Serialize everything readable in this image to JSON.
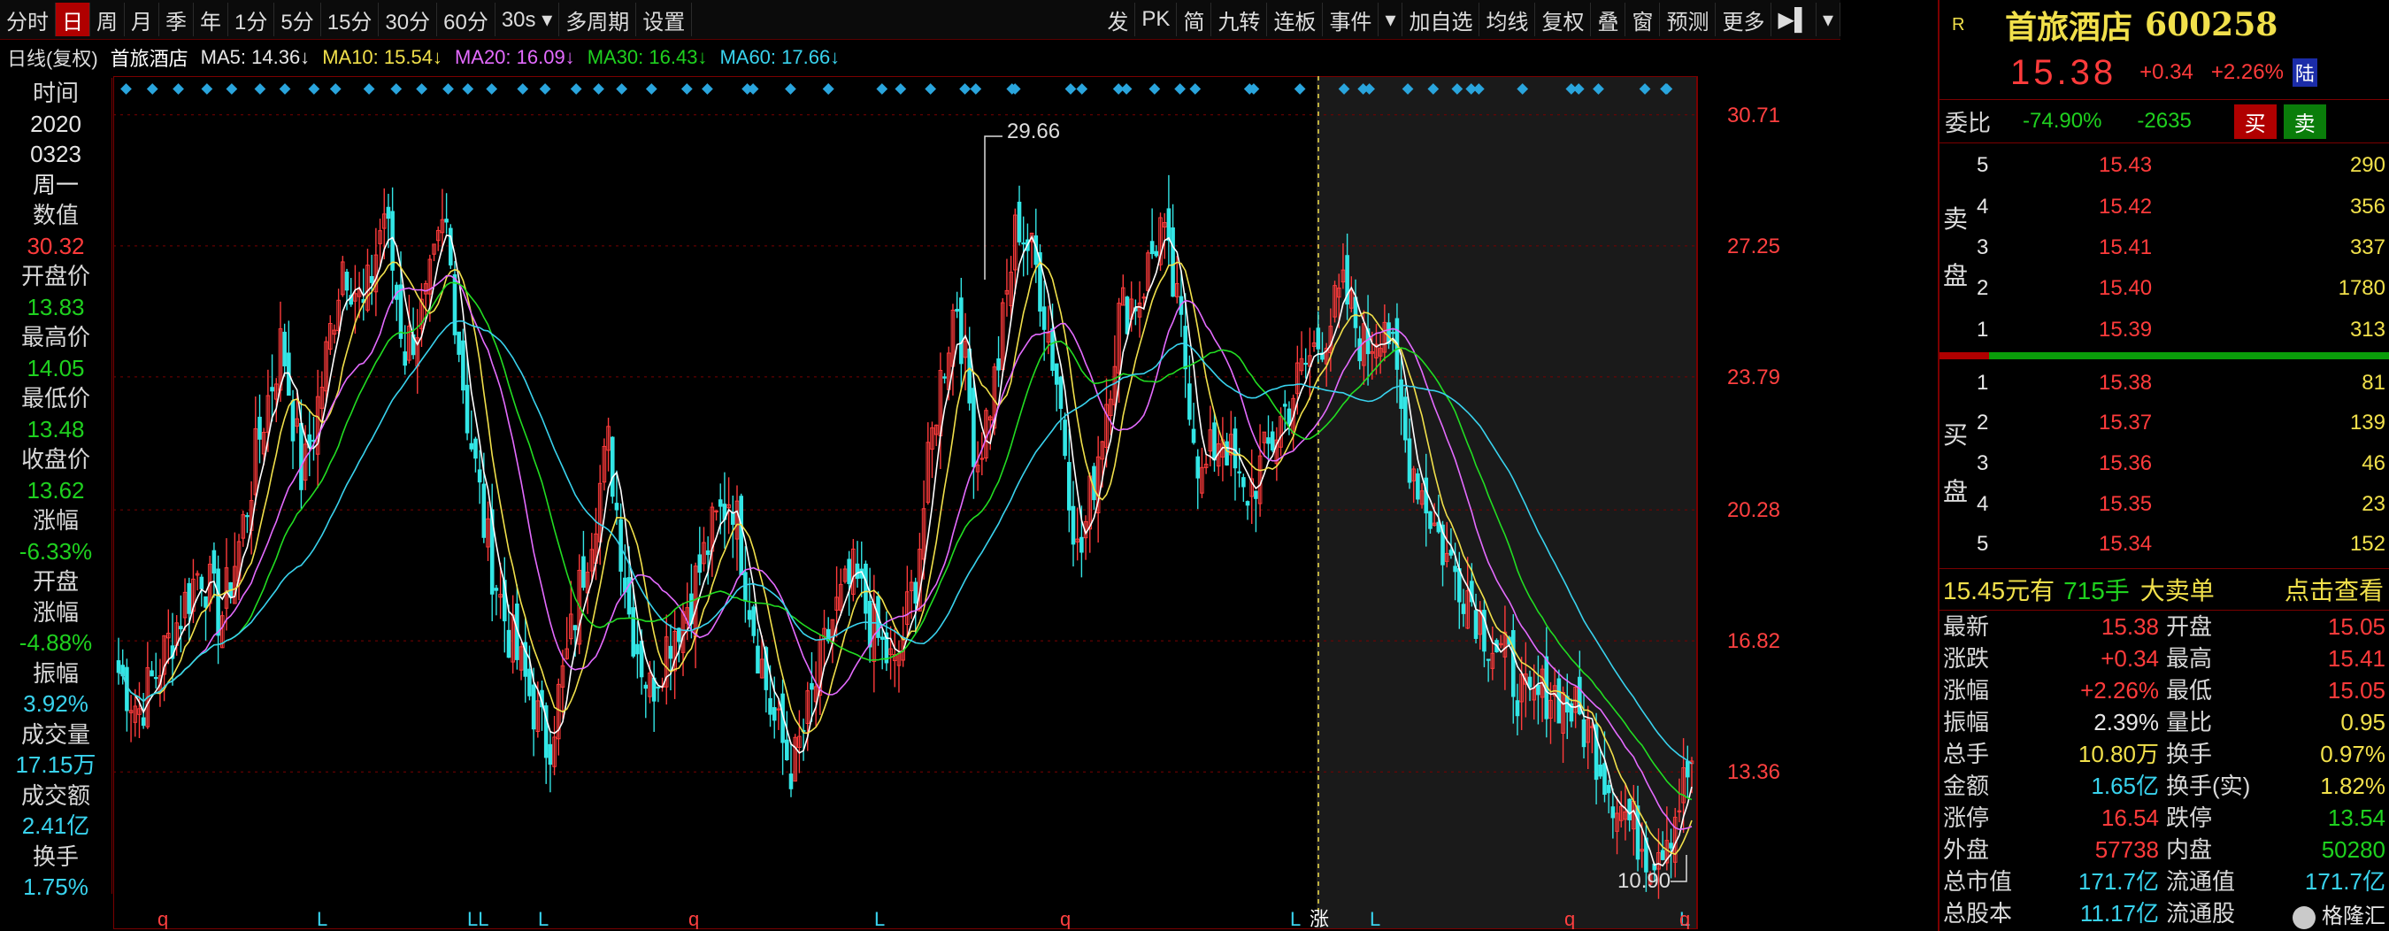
{
  "toolbar": {
    "left_items": [
      "分时",
      "日",
      "周",
      "月",
      "季",
      "年",
      "1分",
      "5分",
      "15分",
      "30分",
      "60分",
      "30s ▾",
      "多周期",
      "设置"
    ],
    "active_index": 1,
    "right_items": [
      "发",
      "PK",
      "简",
      "九转",
      "连板",
      "事件",
      "▾",
      "加自选",
      "均线",
      "复权",
      "叠",
      "窗",
      "预测",
      "更多",
      "▶▌",
      "▾"
    ]
  },
  "ma_line": {
    "period": "日线(复权)",
    "stock": "首旅酒店",
    "ma5": "MA5: 14.36↓",
    "ma10": "MA10: 15.54↓",
    "ma20": "MA20: 16.09↓",
    "ma30": "MA30: 16.43↓",
    "ma60": "MA60: 17.66↓"
  },
  "left_info": {
    "time_label": "时间",
    "year": "2020",
    "date": "0323",
    "weekday": "周一",
    "value_label": "数值",
    "value": "30.32",
    "open_label": "开盘价",
    "open": "13.83",
    "high_label": "最高价",
    "high": "14.05",
    "low_label": "最低价",
    "low": "13.48",
    "close_label": "收盘价",
    "close": "13.62",
    "chg_label": "涨幅",
    "chg": "-6.33%",
    "open_chg_label1": "开盘",
    "open_chg_label2": "涨幅",
    "open_chg": "-4.88%",
    "amp_label": "振幅",
    "amp": "3.92%",
    "vol_label": "成交量",
    "vol": "17.15万",
    "amt_label": "成交额",
    "amt": "2.41亿",
    "turn_label": "换手",
    "turn": "1.75%"
  },
  "chart_data": {
    "type": "candlestick",
    "y_ticks": [
      "30.71",
      "27.25",
      "23.79",
      "20.28",
      "16.82",
      "13.36"
    ],
    "ylim": [
      10.0,
      31.5
    ],
    "annotations": {
      "max": "29.66",
      "min": "10.90",
      "cursor_tag": "涨"
    },
    "series": [
      {
        "name": "MA5"
      },
      {
        "name": "MA10"
      },
      {
        "name": "MA20"
      },
      {
        "name": "MA30"
      },
      {
        "name": "MA60"
      }
    ],
    "bottom_markers": [
      "q",
      "L",
      "LL",
      "L",
      "q",
      "L",
      "q",
      "L",
      "L",
      "q",
      "L",
      "q"
    ],
    "close_path": [
      16.0,
      15.0,
      16.2,
      17.5,
      18.8,
      17.4,
      19.6,
      22.5,
      24.8,
      21.0,
      23.8,
      27.0,
      25.5,
      28.2,
      24.5,
      25.6,
      27.9,
      23.0,
      19.5,
      17.2,
      15.6,
      14.0,
      16.5,
      19.5,
      22.0,
      17.5,
      15.5,
      17.0,
      18.0,
      19.6,
      20.8,
      17.5,
      14.8,
      13.4,
      15.4,
      17.5,
      18.5,
      17.0,
      16.0,
      18.5,
      23.0,
      26.0,
      21.5,
      24.0,
      28.0,
      26.5,
      23.5,
      18.8,
      22.0,
      25.5,
      26.0,
      27.8,
      25.0,
      21.0,
      22.5,
      20.5,
      21.5,
      22.8,
      24.0,
      25.0,
      26.0,
      24.5,
      25.5,
      22.0,
      20.5,
      19.0,
      18.2,
      17.0,
      16.2,
      15.0,
      15.6,
      15.1,
      14.4,
      13.0,
      12.0,
      11.2,
      12.0,
      13.62
    ]
  },
  "quote": {
    "badge": "R",
    "name": "首旅酒店",
    "code": "600258",
    "price": "15.38",
    "change": "+0.34",
    "change_pct": "+2.26%",
    "market_tag": "陆",
    "wei_label": "委比",
    "wei_ratio": "-74.90%",
    "wei_diff": "-2635",
    "buy_btn": "买",
    "sell_btn": "卖",
    "sell_label": "卖盘",
    "buy_label": "买盘",
    "asks": [
      {
        "level": "5",
        "price": "15.43",
        "vol": "290"
      },
      {
        "level": "4",
        "price": "15.42",
        "vol": "356"
      },
      {
        "level": "3",
        "price": "15.41",
        "vol": "337"
      },
      {
        "level": "2",
        "price": "15.40",
        "vol": "1780"
      },
      {
        "level": "1",
        "price": "15.39",
        "vol": "313"
      }
    ],
    "bids": [
      {
        "level": "1",
        "price": "15.38",
        "vol": "81"
      },
      {
        "level": "2",
        "price": "15.37",
        "vol": "139"
      },
      {
        "level": "3",
        "price": "15.36",
        "vol": "46"
      },
      {
        "level": "4",
        "price": "15.35",
        "vol": "23"
      },
      {
        "level": "5",
        "price": "15.34",
        "vol": "152"
      }
    ],
    "alert": {
      "left": "15.45元有",
      "mid": "715手",
      "right": "大卖单",
      "link": "点击查看"
    },
    "stats": [
      {
        "l1": "最新",
        "v1": "15.38",
        "c1": "red",
        "l2": "开盘",
        "v2": "15.05",
        "c2": "red"
      },
      {
        "l1": "涨跌",
        "v1": "+0.34",
        "c1": "red",
        "l2": "最高",
        "v2": "15.41",
        "c2": "red"
      },
      {
        "l1": "涨幅",
        "v1": "+2.26%",
        "c1": "red",
        "l2": "最低",
        "v2": "15.05",
        "c2": "red"
      },
      {
        "l1": "振幅",
        "v1": "2.39%",
        "c1": "white",
        "l2": "量比",
        "v2": "0.95",
        "c2": "yellow"
      },
      {
        "l1": "总手",
        "v1": "10.80万",
        "c1": "yellow",
        "l2": "换手",
        "v2": "0.97%",
        "c2": "yellow"
      },
      {
        "l1": "金额",
        "v1": "1.65亿",
        "c1": "cyan",
        "l2": "换手(实)",
        "v2": "1.82%",
        "c2": "yellow"
      },
      {
        "l1": "涨停",
        "v1": "16.54",
        "c1": "red",
        "l2": "跌停",
        "v2": "13.54",
        "c2": "green"
      },
      {
        "l1": "外盘",
        "v1": "57738",
        "c1": "red",
        "l2": "内盘",
        "v2": "50280",
        "c2": "green"
      },
      {
        "l1": "总市值",
        "v1": "171.7亿",
        "c1": "cyan",
        "l2": "流通值",
        "v2": "171.7亿",
        "c2": "cyan"
      },
      {
        "l1": "总股本",
        "v1": "11.17亿",
        "c1": "cyan",
        "l2": "流通股",
        "v2": "",
        "c2": "cyan"
      }
    ],
    "watermark": "格隆汇"
  },
  "colors": {
    "up": "#ff3b3b",
    "down": "#33e6e6",
    "ma5": "#ffffff",
    "ma10": "#f1e04b",
    "ma20": "#e46bff",
    "ma30": "#22dd22",
    "ma60": "#39d3ee",
    "grid": "#7a0000"
  }
}
